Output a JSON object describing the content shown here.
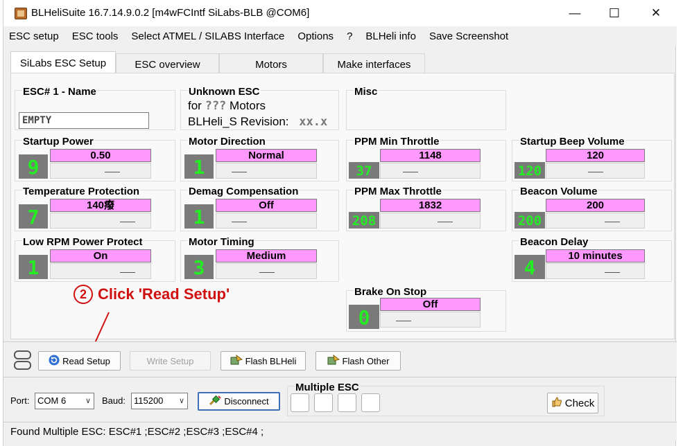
{
  "window": {
    "title": "BLHeliSuite 16.7.14.9.0.2  [m4wFCIntf SiLabs-BLB @COM6]",
    "minimize": "—",
    "maximize": "☐",
    "close": "✕"
  },
  "menu": [
    "ESC setup",
    "ESC tools",
    "Select ATMEL / SILABS Interface",
    "Options",
    "?",
    "BLHeli info",
    "Save Screenshot"
  ],
  "tabs": [
    "SiLabs ESC Setup",
    "ESC overview",
    "Motors",
    "Make interfaces"
  ],
  "esc_name": {
    "title": "ESC# 1 - Name",
    "value": "EMPTY"
  },
  "esc_info": {
    "title": "Unknown ESC",
    "for_label": "for",
    "motors_value": "???",
    "motors_label": "Motors",
    "revision_label": "BLHeli_S Revision:",
    "revision_value": "xx.x"
  },
  "misc": {
    "title": "Misc"
  },
  "params": {
    "startup_power": {
      "title": "Startup Power",
      "value": "0.50",
      "digit": "9"
    },
    "motor_direction": {
      "title": "Motor Direction",
      "value": "Normal",
      "digit": "1"
    },
    "ppm_min": {
      "title": "PPM Min Throttle",
      "value": "1148",
      "digit": "37"
    },
    "startup_beep": {
      "title": "Startup Beep Volume",
      "value": "120",
      "digit": "120"
    },
    "temp_protection": {
      "title": "Temperature Protection",
      "value": "140癈",
      "digit": "7"
    },
    "demag": {
      "title": "Demag Compensation",
      "value": "Off",
      "digit": "1"
    },
    "ppm_max": {
      "title": "PPM Max Throttle",
      "value": "1832",
      "digit": "208"
    },
    "beacon_volume": {
      "title": "Beacon Volume",
      "value": "200",
      "digit": "200"
    },
    "low_rpm": {
      "title": "Low RPM Power Protect",
      "value": "On",
      "digit": "1"
    },
    "motor_timing": {
      "title": "Motor Timing",
      "value": "Medium",
      "digit": "3"
    },
    "beacon_delay": {
      "title": "Beacon Delay",
      "value": "10 minutes",
      "digit": "4"
    },
    "brake_on_stop": {
      "title": "Brake On Stop",
      "value": "Off",
      "digit": "0"
    }
  },
  "annotation": {
    "step": "2",
    "text": "Click 'Read Setup'"
  },
  "buttons": {
    "read_setup": "Read Setup",
    "write_setup": "Write Setup",
    "flash_blheli": "Flash BLHeli",
    "flash_other": "Flash Other"
  },
  "connection": {
    "port_label": "Port:",
    "port_value": "COM 6",
    "baud_label": "Baud:",
    "baud_value": "115200",
    "disconnect": "Disconnect",
    "multiple_esc_title": "Multiple ESC",
    "check": "Check"
  },
  "status": "Found Multiple ESC: ESC#1 ;ESC#2 ;ESC#3 ;ESC#4 ;",
  "colors": {
    "value_box": "#ff99ff",
    "digit_text": "#22ee22",
    "digit_bg": "#7a7a7a",
    "annotation": "#d01010"
  }
}
